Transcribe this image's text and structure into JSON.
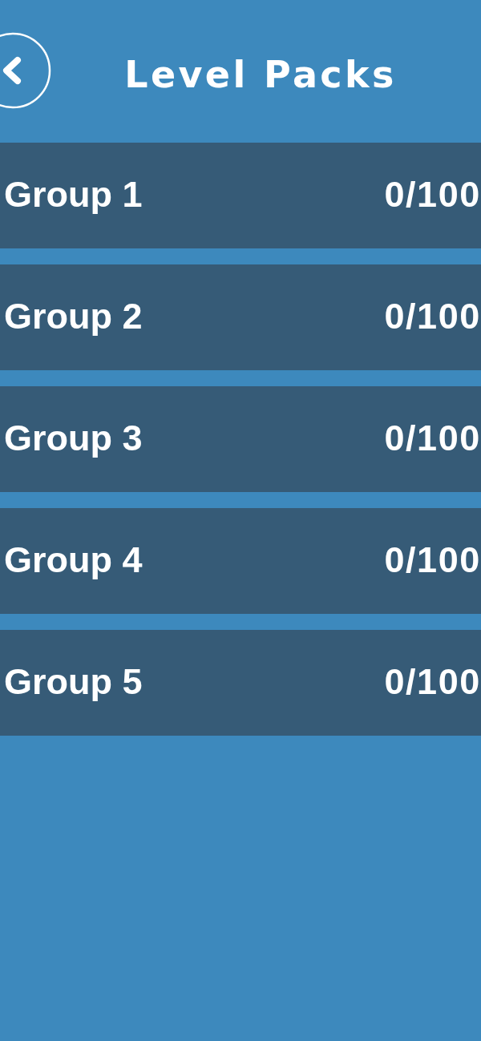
{
  "header": {
    "title": "Level Packs"
  },
  "groups": [
    {
      "name": "Group 1",
      "count": "0/100"
    },
    {
      "name": "Group 2",
      "count": "0/100"
    },
    {
      "name": "Group 3",
      "count": "0/100"
    },
    {
      "name": "Group 4",
      "count": "0/100"
    },
    {
      "name": "Group 5",
      "count": "0/100"
    }
  ]
}
